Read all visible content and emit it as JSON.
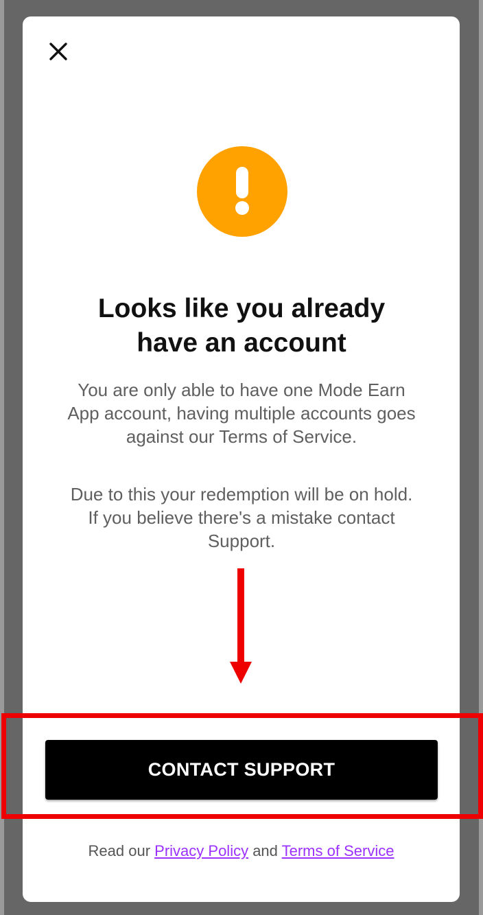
{
  "dialog": {
    "close_label": "×",
    "title_line1": "Looks like you already",
    "title_line2": "have an account",
    "paragraph1": {
      "line1": "You are only able to have one Mode Earn",
      "line2": "App account, having multiple accounts goes",
      "line3": "against our Terms of Service."
    },
    "paragraph2": {
      "line1": "Due to this your redemption will be on hold.",
      "line2": "If you believe there's a mistake contact",
      "line3": "Support."
    },
    "contact_button_label": "CONTACT SUPPORT",
    "legal": {
      "prefix": "Read our ",
      "privacy_link": "Privacy Policy",
      "conjunction": " and ",
      "terms_link": "Terms of Service"
    }
  },
  "icons": {
    "close": "close-icon",
    "alert": "exclamation-icon"
  },
  "colors": {
    "alert": "#FFA200",
    "button_background": "#000000",
    "link": "#9B30FF",
    "annotation": "#EE0000",
    "backdrop": "#666666"
  }
}
